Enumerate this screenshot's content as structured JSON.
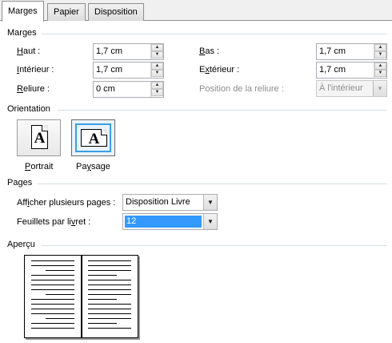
{
  "tabs": [
    {
      "label": "Marges",
      "active": true
    },
    {
      "label": "Papier",
      "active": false
    },
    {
      "label": "Disposition",
      "active": false
    }
  ],
  "margins": {
    "section_title": "Marges",
    "top": {
      "label_hot": "H",
      "label_rest": "aut :",
      "value": "1,7 cm"
    },
    "inner": {
      "label_hot": "I",
      "label_rest": "ntérieur :",
      "value": "1,7 cm"
    },
    "gutter": {
      "label_hot": "R",
      "label_rest": "eliure :",
      "value": "0 cm"
    },
    "bottom": {
      "label_hot": "B",
      "label_rest": "as :",
      "value": "1,7 cm"
    },
    "outer": {
      "label_pre": "E",
      "label_hot": "x",
      "label_rest": "térieur :",
      "value": "1,7 cm"
    },
    "gutter_position": {
      "label": "Position de la reliure :",
      "value": "À l'intérieur",
      "disabled": true
    }
  },
  "orientation": {
    "section_title": "Orientation",
    "portrait": {
      "label_hot": "P",
      "label_rest": "ortrait",
      "glyph": "A"
    },
    "landscape": {
      "label_pre": "Pa",
      "label_hot": "y",
      "label_rest": "sage",
      "glyph": "A",
      "selected": true
    }
  },
  "pages": {
    "section_title": "Pages",
    "multiple_pages": {
      "label_pre": "Aff",
      "label_hot": "i",
      "label_rest": "cher plusieurs pages :",
      "value": "Disposition Livre"
    },
    "sheets_per_booklet": {
      "label_pre": "Feuillets par li",
      "label_hot": "v",
      "label_rest": "ret :",
      "value": "12"
    }
  },
  "preview": {
    "section_title": "Aperçu"
  },
  "icons": {
    "spin_up": "▲",
    "spin_down": "▼",
    "dropdown": "▼"
  }
}
